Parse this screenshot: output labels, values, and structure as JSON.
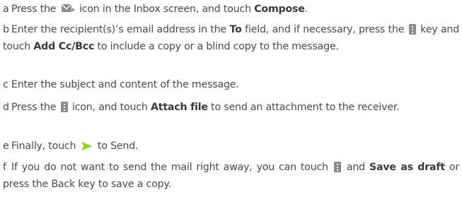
{
  "steps": [
    {
      "letter": "a",
      "t1": "Press the",
      "t2": "icon in the Inbox screen, and touch",
      "b1": "Compose",
      "t3": "."
    },
    {
      "letter": "b",
      "t1": "Enter the recipient(s)’s email address in the",
      "b1": "To",
      "t2": "field, and if necessary, press the",
      "t3": "key and touch",
      "b2": "Add Cc/Bcc",
      "t4": "to include a copy or a blind copy to the message."
    },
    {
      "letter": "c",
      "t1": "Enter the subject and content of the message."
    },
    {
      "letter": "d",
      "t1": "Press the",
      "t2": "icon, and touch",
      "b1": "Attach file",
      "t3": "to send an attachment to the receiver."
    },
    {
      "letter": "e",
      "t1": "Finally, touch",
      "t2": "to Send."
    },
    {
      "letter": "f",
      "t1": "If you do not want to send the mail right away, you can touch",
      "t2": "and",
      "b1": "Save as draft",
      "t3": "or press the Back key to save a copy."
    }
  ],
  "icons": {
    "compose": "compose-mail-icon",
    "menu": "menu-icon",
    "send": "send-icon"
  },
  "colors": {
    "text": "#4a4a4a",
    "icon_gray": "#8c8c8c",
    "send_green": "#8ed21f"
  }
}
